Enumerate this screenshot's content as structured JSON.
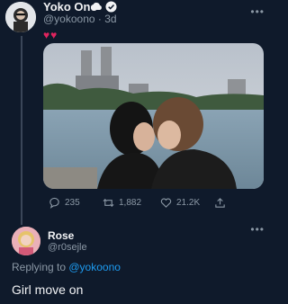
{
  "tweet": {
    "author_name": "Yoko Ono",
    "handle_time": "@yokoono · 3d",
    "emoji_text": "♥♥",
    "more_icon": "more-dots-icon",
    "stats": {
      "replies": "235",
      "retweets": "1,882",
      "likes": "21.2K"
    }
  },
  "reply": {
    "author_name": "Rose",
    "handle": "@r0sejle",
    "replying_prefix": "Replying to ",
    "replying_to": "@yokoono",
    "text": "Girl move on"
  },
  "colors": {
    "background": "#0f1a2b",
    "accent": "#1d9bf0",
    "muted": "#8b98a5",
    "heart": "#e0245e"
  }
}
